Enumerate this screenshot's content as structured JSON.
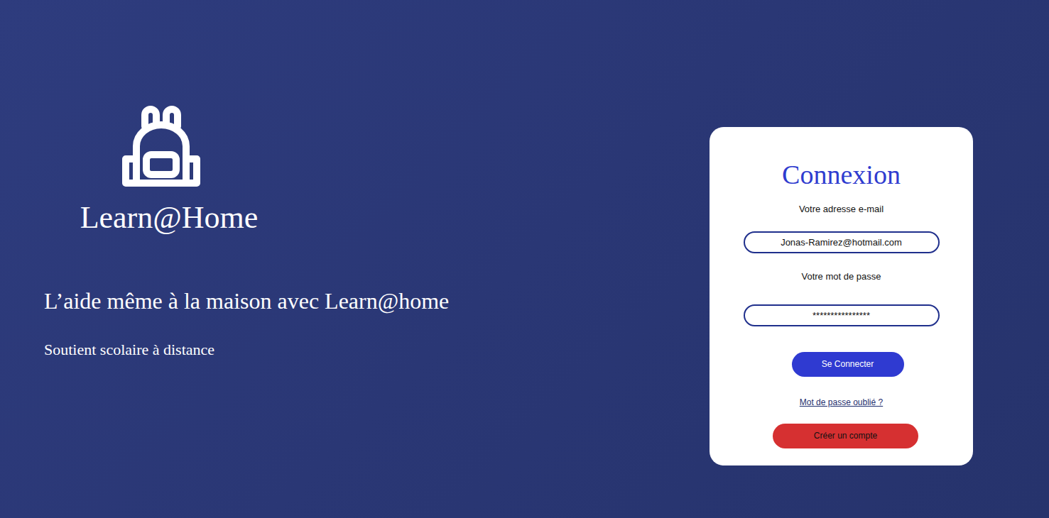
{
  "brand": {
    "name": "Learn@Home",
    "tagline": "L’aide même à la maison avec Learn@home",
    "subtitle": "Soutient scolaire à distance"
  },
  "login": {
    "title": "Connexion",
    "email_label": "Votre adresse e-mail",
    "email_value": "Jonas-Ramirez@hotmail.com",
    "password_label": "Votre mot de passe",
    "password_value": "****************",
    "submit": "Se Connecter",
    "forgot": "Mot de passe oublié ?",
    "register": "Créer un compte"
  }
}
